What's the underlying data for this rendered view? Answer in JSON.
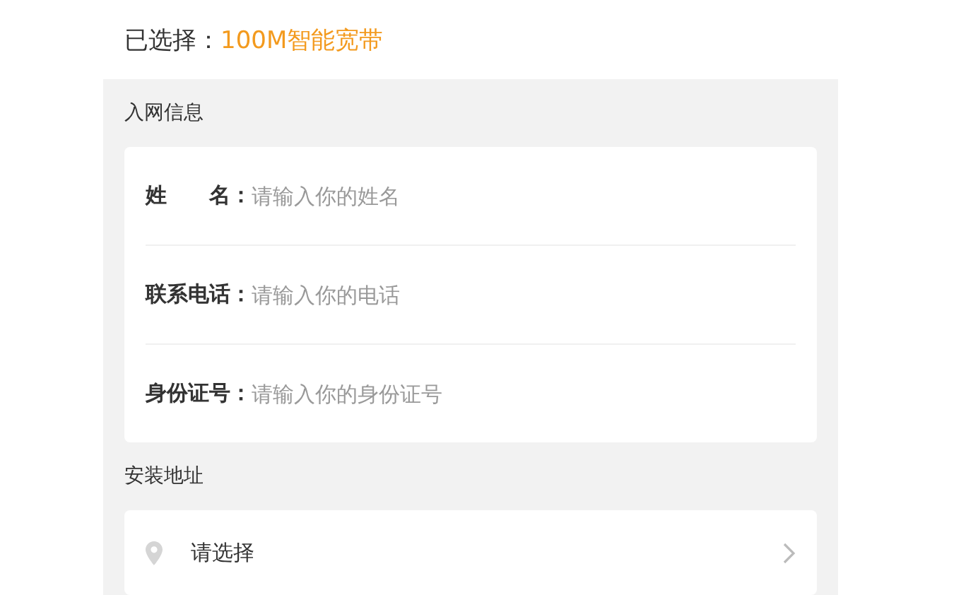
{
  "selection": {
    "label": "已选择：",
    "value": "100M智能宽带"
  },
  "sections": [
    {
      "title": "入网信息",
      "kind": "fields",
      "rows": [
        {
          "label": "姓　　名：",
          "placeholder": "请输入你的姓名"
        },
        {
          "label": "联系电话：",
          "placeholder": "请输入你的电话"
        },
        {
          "label": "身份证号：",
          "placeholder": "请输入你的身份证号"
        }
      ]
    },
    {
      "title": "安装地址",
      "kind": "picker",
      "rows": [
        {
          "label": "请选择"
        }
      ]
    }
  ]
}
